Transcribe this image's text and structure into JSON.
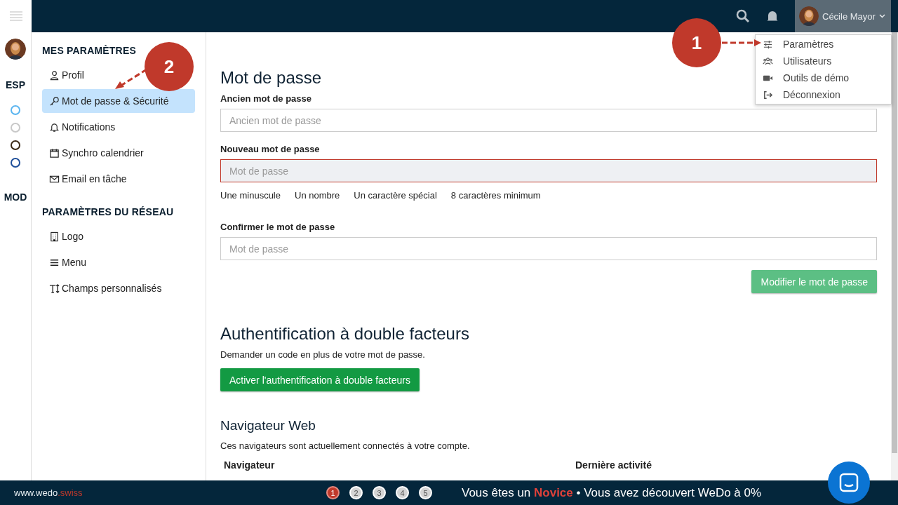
{
  "topbar": {
    "user_name": "Cécile Mayor"
  },
  "user_menu": [
    {
      "label": "Paramètres",
      "kind": "sliders"
    },
    {
      "label": "Utilisateurs",
      "kind": "users"
    },
    {
      "label": "Outils de démo",
      "kind": "video"
    },
    {
      "label": "Déconnexion",
      "kind": "logout"
    }
  ],
  "rail": {
    "sections": [
      "ESP",
      "MOD"
    ],
    "spaces": [
      {
        "color": "#5bb5f0"
      },
      {
        "color": "#c8c8c8"
      },
      {
        "color": "#3b2a17"
      },
      {
        "color": "#1f4f9a"
      }
    ]
  },
  "sidebar": {
    "groups": [
      {
        "title": "MES PARAMÈTRES",
        "items": [
          {
            "label": "Profil",
            "kind": "user",
            "selected": false
          },
          {
            "label": "Mot de passe & Sécurité",
            "kind": "key",
            "selected": true
          },
          {
            "label": "Notifications",
            "kind": "bell",
            "selected": false
          },
          {
            "label": "Synchro calendrier",
            "kind": "calendar",
            "selected": false
          },
          {
            "label": "Email en tâche",
            "kind": "mail",
            "selected": false
          }
        ]
      },
      {
        "title": "PARAMÈTRES DU RÉSEAU",
        "items": [
          {
            "label": "Logo",
            "kind": "building",
            "selected": false
          },
          {
            "label": "Menu",
            "kind": "bars",
            "selected": false
          },
          {
            "label": "Champs personnalisés",
            "kind": "text",
            "selected": false
          }
        ]
      }
    ]
  },
  "password": {
    "title": "Mot de passe",
    "fields": [
      {
        "label": "Ancien mot de passe",
        "placeholder": "Ancien mot de passe",
        "invalid": false
      },
      {
        "label": "Nouveau mot de passe",
        "placeholder": "Mot de passe",
        "invalid": true,
        "rules": [
          "Une minuscule",
          "Un nombre",
          "Un caractère spécial",
          "8 caractères minimum"
        ]
      },
      {
        "label": "Confirmer le mot de passe",
        "placeholder": "Mot de passe",
        "invalid": false
      }
    ],
    "button": {
      "label": "Modifier le mot de passe",
      "disabled": true
    }
  },
  "two_factor": {
    "title": "Authentification à double facteurs",
    "description": "Demander un code en plus de votre mot de passe.",
    "button": {
      "label": "Activer l'authentification à double facteurs",
      "disabled": false
    }
  },
  "browsers": {
    "title": "Navigateur Web",
    "description": "Ces navigateurs sont actuellement connectés à votre compte.",
    "columns": [
      "Navigateur",
      "Dernière activité"
    ]
  },
  "footer": {
    "site": "www.wedo",
    "site_suffix": ".swiss",
    "steps": [
      {
        "label": "1",
        "selected": true
      },
      {
        "label": "2",
        "selected": false
      },
      {
        "label": "3",
        "selected": false
      },
      {
        "label": "4",
        "selected": false
      },
      {
        "label": "5",
        "selected": false
      }
    ],
    "message_prefix": "Vous êtes un ",
    "level": "Novice",
    "message_suffix": " • Vous avez découvert WeDo à 0%"
  },
  "callouts": [
    {
      "label": "1"
    },
    {
      "label": "2"
    }
  ]
}
